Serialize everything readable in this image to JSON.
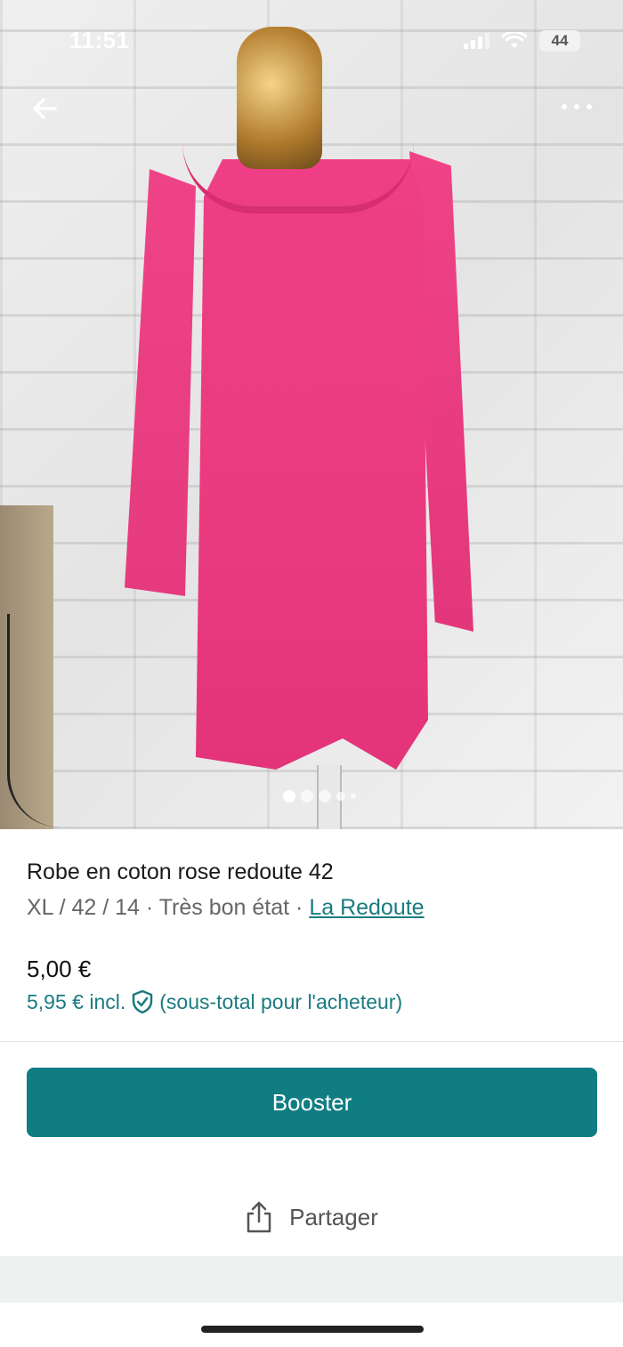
{
  "status_bar": {
    "time": "11:51",
    "battery": "44"
  },
  "nav": {
    "back_icon": "arrow-left-icon",
    "more_icon": "more-dots-icon"
  },
  "carousel": {
    "image_count": 5,
    "active_index": 0
  },
  "item": {
    "title": "Robe en coton rose redoute 42",
    "details": "XL / 42 / 14 · Très bon état · ",
    "brand": "La Redoute",
    "price": "5,00 €",
    "price_incl": "5,95 € incl.",
    "buyer_note": "(sous-total pour l'acheteur)"
  },
  "actions": {
    "booster_label": "Booster",
    "share_label": "Partager"
  },
  "colors": {
    "accent": "#0f7d82",
    "link": "#1a7b80"
  }
}
